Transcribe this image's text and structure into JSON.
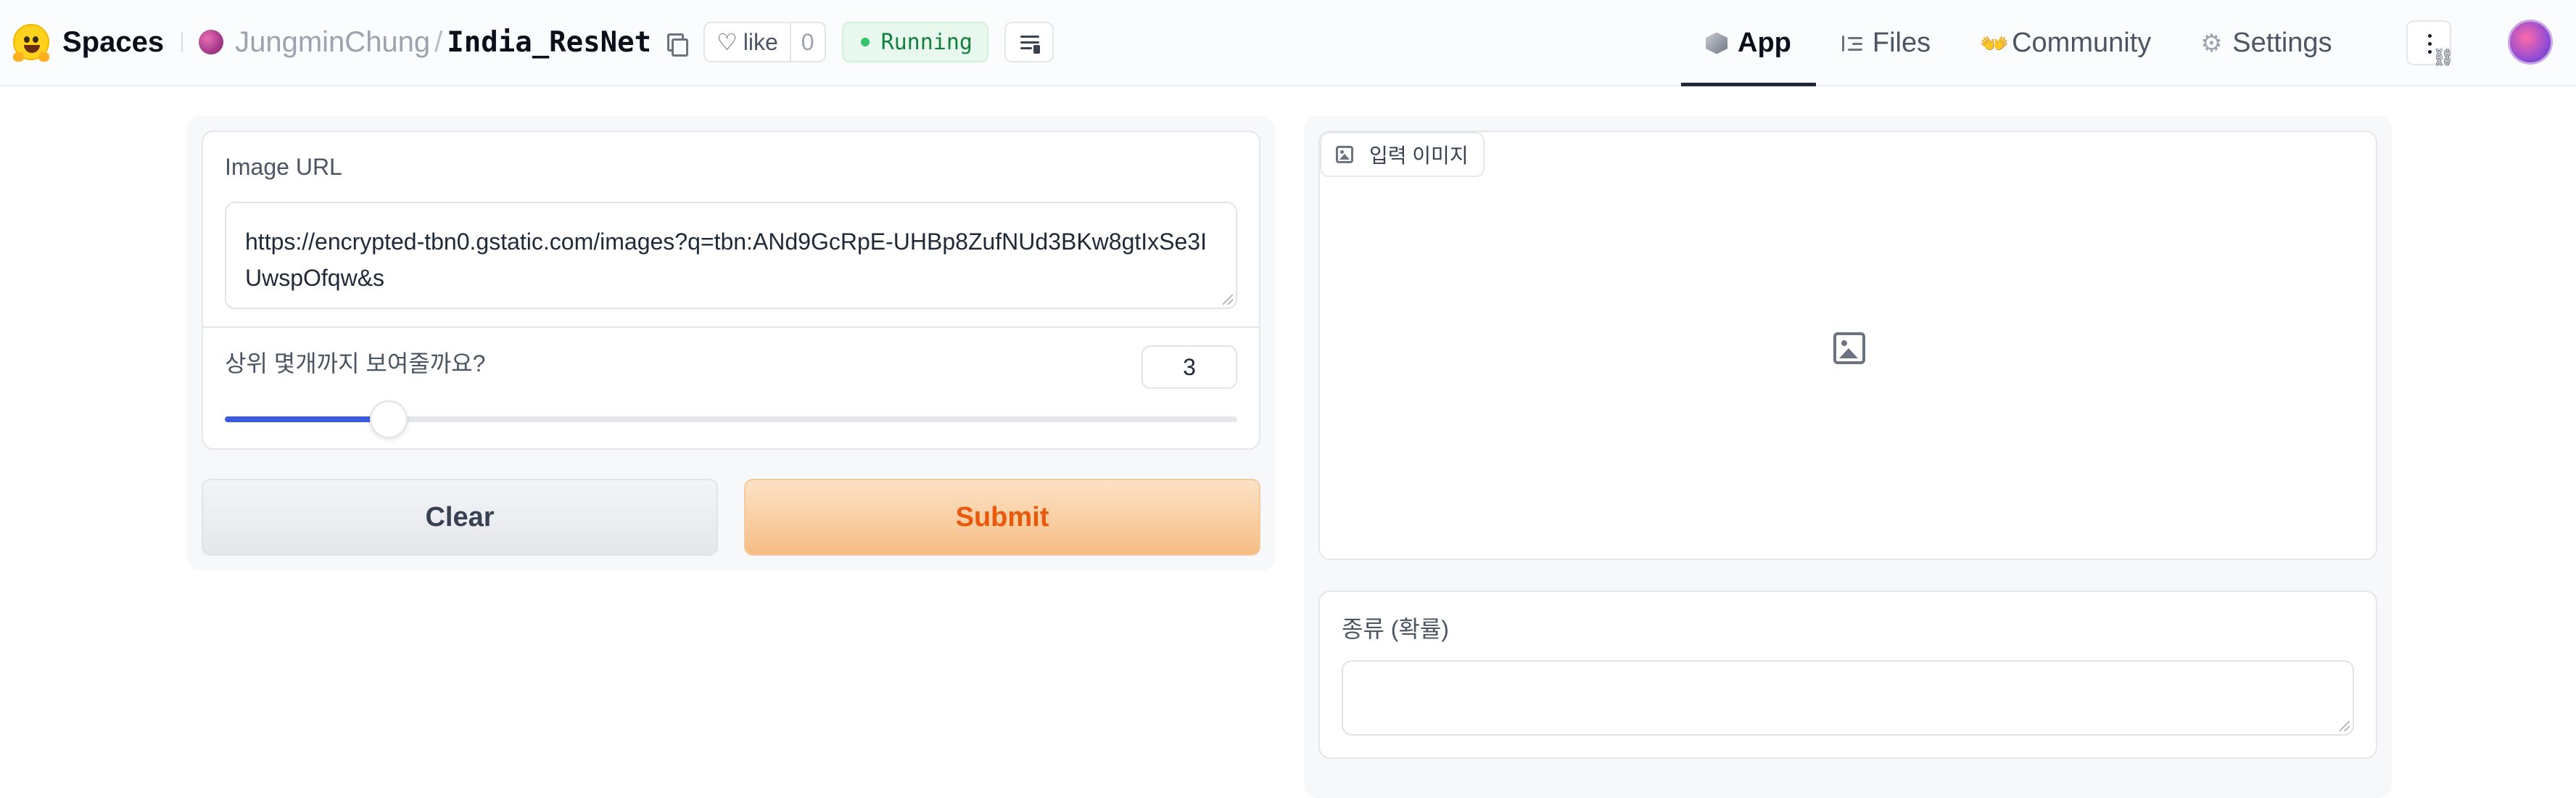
{
  "header": {
    "brand": "Spaces",
    "owner": "JungminChung",
    "separator": "/",
    "repo_name": "India_ResNet",
    "like_label": "like",
    "like_count": "0",
    "status": "Running",
    "status_color": "#15803d"
  },
  "nav": {
    "tabs": [
      {
        "label": "App",
        "icon": "cube-icon",
        "active": true
      },
      {
        "label": "Files",
        "icon": "files-icon",
        "active": false
      },
      {
        "label": "Community",
        "icon": "community-icon",
        "active": false
      },
      {
        "label": "Settings",
        "icon": "gear-icon",
        "active": false
      }
    ]
  },
  "inputs": {
    "image_url_label": "Image URL",
    "image_url_value": "https://encrypted-tbn0.gstatic.com/images?q=tbn:ANd9GcRpE-UHBp8ZufNUd3BKw8gtIxSe3IUwspOfqw&s",
    "topk_label": "상위 몇개까지 보여줄까요?",
    "topk_value": "3",
    "clear_label": "Clear",
    "submit_label": "Submit"
  },
  "outputs": {
    "image_label": "입력 이미지",
    "class_label": "종류 (확률)",
    "class_value": ""
  },
  "colors": {
    "accent": "#3b5bdb",
    "submit_text": "#ea580c",
    "submit_bg": "#f6bd84"
  }
}
